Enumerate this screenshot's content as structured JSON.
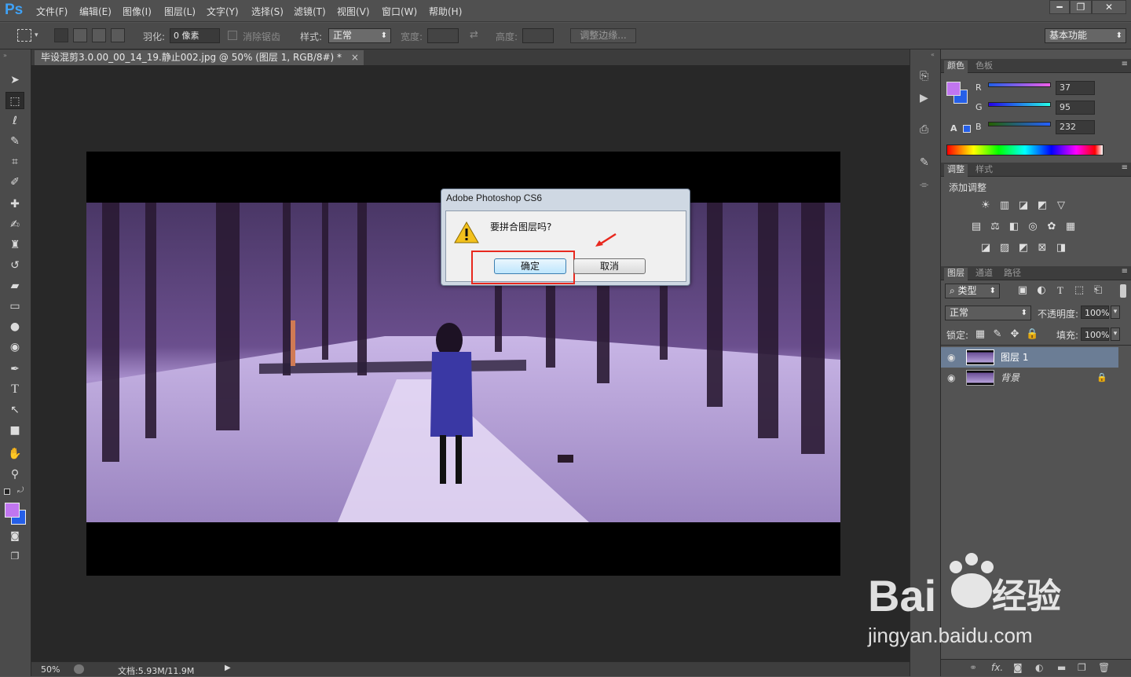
{
  "app": {
    "logo": "Ps"
  },
  "menubar": {
    "items": [
      "文件(F)",
      "编辑(E)",
      "图像(I)",
      "图层(L)",
      "文字(Y)",
      "选择(S)",
      "滤镜(T)",
      "视图(V)",
      "窗口(W)",
      "帮助(H)"
    ]
  },
  "window_controls": {
    "minimize": "━",
    "restore": "❐",
    "close": "✕"
  },
  "options": {
    "feather_label": "羽化:",
    "feather_value": "0 像素",
    "antialias_label": "消除锯齿",
    "style_label": "样式:",
    "style_value": "正常",
    "width_label": "宽度:",
    "height_label": "高度:",
    "refine_edge": "调整边缘...",
    "workspace": "基本功能"
  },
  "document": {
    "tab_title": "毕设混剪3.0.00_00_14_19.静止002.jpg @ 50% (图层 1, RGB/8#) *",
    "tab_close": "×"
  },
  "status": {
    "zoom": "50%",
    "doc_info": "文档:5.93M/11.9M"
  },
  "color_panel": {
    "tabs": [
      "颜色",
      "色板"
    ],
    "r_label": "R",
    "g_label": "G",
    "b_label": "B",
    "r": "37",
    "g": "95",
    "b": "232",
    "foreground": "#c176f0",
    "background": "#255fe8"
  },
  "adjust_panel": {
    "tabs": [
      "调整",
      "样式"
    ],
    "heading": "添加调整"
  },
  "layers_panel": {
    "tabs": [
      "图层",
      "通道",
      "路径"
    ],
    "filter_label": "类型",
    "blend_mode": "正常",
    "opacity_label": "不透明度:",
    "opacity_value": "100%",
    "lock_label": "锁定:",
    "fill_label": "填充:",
    "fill_value": "100%",
    "layers": [
      {
        "name": "图层 1",
        "selected": true
      },
      {
        "name": "背景",
        "selected": false,
        "locked": true
      }
    ],
    "footer_fx": "fx."
  },
  "dialog": {
    "title": "Adobe Photoshop CS6",
    "message": "要拼合图层吗?",
    "ok": "确定",
    "cancel": "取消"
  },
  "watermark": {
    "url": "jingyan.baidu.com"
  }
}
